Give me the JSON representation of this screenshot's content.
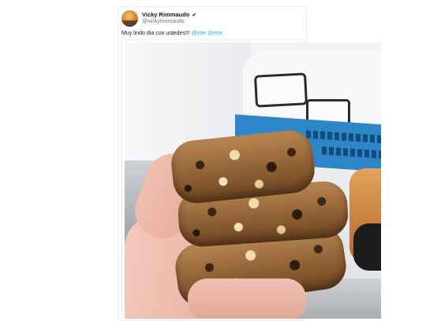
{
  "tweet": {
    "display_name": "Vicky Rimmaudo",
    "verified_mark": "✔",
    "handle": "@vickyrimmaudo",
    "text": "Muy lindo dia con ustedes!!! ",
    "mentions": [
      "@zoe",
      "@emi"
    ]
  },
  "media": {
    "icon": "photo-cookies"
  },
  "colors": {
    "mention": "#1da1f2",
    "text": "#14171a",
    "handle": "#657786",
    "border": "#e6ecf0"
  }
}
